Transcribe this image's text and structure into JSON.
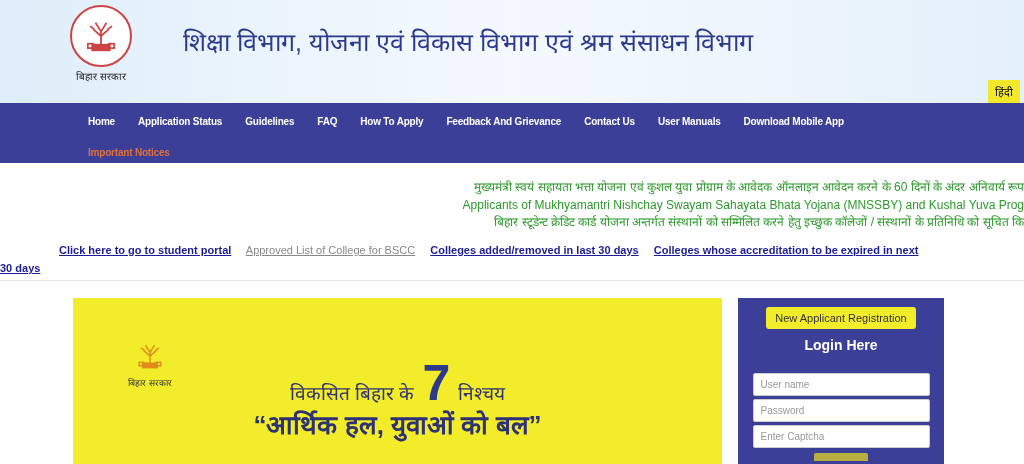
{
  "header": {
    "emblem_caption": "बिहार सरकार",
    "title": "शिक्षा विभाग, योजना एवं विकास विभाग एवं श्रम संसाधन विभाग",
    "language_button": "हिंदी"
  },
  "nav": {
    "items": [
      {
        "label": "Home",
        "kind": "normal"
      },
      {
        "label": "Application Status",
        "kind": "normal"
      },
      {
        "label": "Guidelines",
        "kind": "normal"
      },
      {
        "label": "FAQ",
        "kind": "normal"
      },
      {
        "label": "How To Apply",
        "kind": "normal"
      },
      {
        "label": "Feedback And Grievance",
        "kind": "normal"
      },
      {
        "label": "Contact Us",
        "kind": "normal"
      },
      {
        "label": "User Manuals",
        "kind": "normal"
      },
      {
        "label": "Download Mobile App",
        "kind": "normal"
      },
      {
        "label": "Important Notices",
        "kind": "notice"
      }
    ]
  },
  "notices": [
    "मुख्यमंत्री स्वयं सहायता भत्ता योजना एवं कुशल युवा प्रोग्राम के आवेदक ऑनलाइन आवेदन करने के 60 दिनों के अंदर अनिवार्य रूप",
    "Applicants of Mukhyamantri Nishchay Swayam Sahayata Bhata Yojana (MNSSBY) and Kushal Yuva Prog",
    "बिहार स्टूडेन्ट क्रेडिट कार्ड योजना अन्तर्गत संस्थानों को सम्मिलित करने हेतु इच्छुक कॉलेजों / संस्थानों के प्रतिनिधि को सूचित कि"
  ],
  "quick_links": [
    {
      "label": "Click here to go to student portal",
      "visited": false
    },
    {
      "label": "Approved List of College for BSCC",
      "visited": true
    },
    {
      "label": "Colleges added/removed in last 30 days",
      "visited": false
    },
    {
      "label_lines": [
        "Colleges whose accreditation to be expired in next",
        "30 days"
      ],
      "visited": false
    }
  ],
  "banner": {
    "emblem_caption": "बिहार सरकार",
    "slogan_before": "विकसित बिहार के",
    "slogan_number": "7",
    "slogan_after": "निश्चय",
    "quote": "“आर्थिक हल, युवाओं को बल”"
  },
  "login": {
    "register_button": "New Applicant Registration",
    "heading": "Login Here",
    "fields": [
      {
        "placeholder": "User name"
      },
      {
        "placeholder": "Password"
      },
      {
        "placeholder": "Enter Captcha"
      }
    ]
  }
}
